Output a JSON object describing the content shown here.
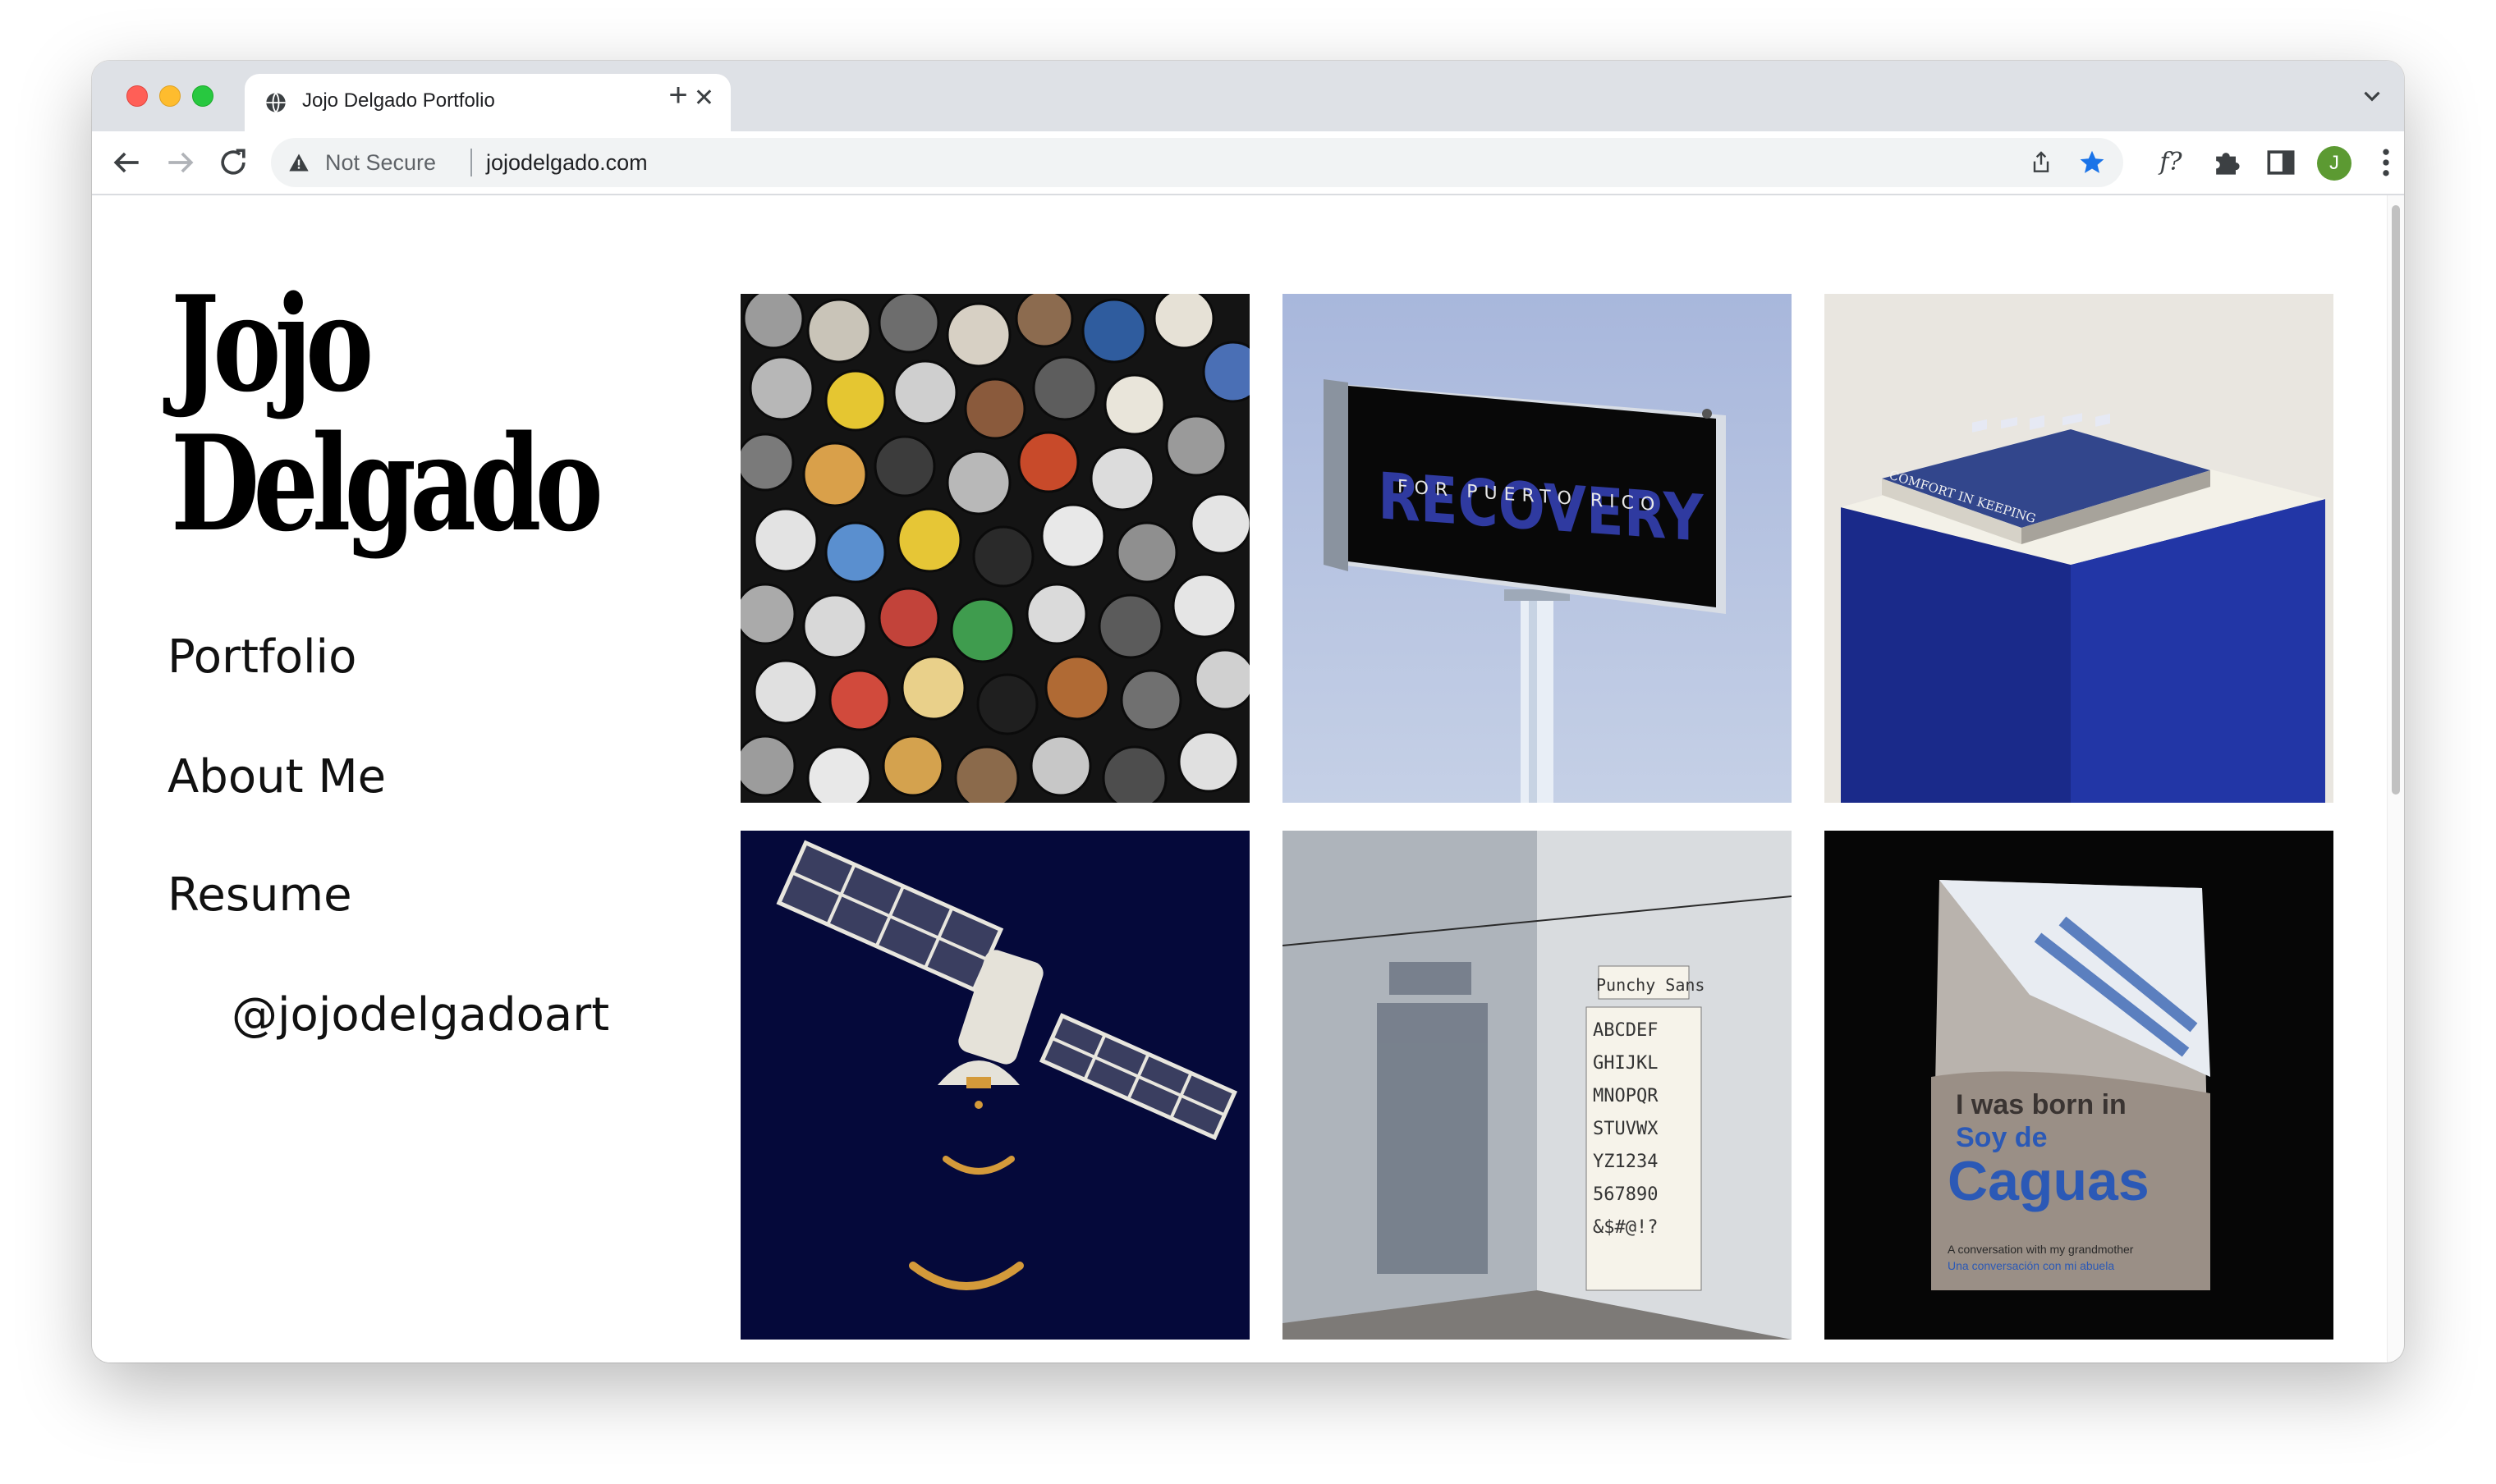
{
  "browser": {
    "tab_title": "Jojo Delgado Portfolio",
    "tab_close": "✕",
    "new_tab": "+",
    "security_label": "Not Secure",
    "url": "jojodelgado.com",
    "profile_initial": "J",
    "ext_font_label": "f?",
    "icons": [
      "globe-icon",
      "back-icon",
      "forward-icon",
      "reload-icon",
      "warning-icon",
      "share-icon",
      "star-icon",
      "puzzle-icon",
      "side-panel-icon",
      "kebab-menu-icon",
      "tab-search-icon"
    ]
  },
  "site": {
    "logo_line1": "Jojo",
    "logo_line2": "Delgado",
    "nav": {
      "portfolio": "Portfolio",
      "about": "About Me",
      "resume": "Resume",
      "instagram": "@jojodelgadoart"
    }
  },
  "gallery": {
    "tile2_text_main": "RECOVERY",
    "tile2_text_sub": "FOR PUERTO RICO",
    "tile3_text": "COMFORT IN KEEPING",
    "tile5_text_1": "Punchy Sans",
    "tile6_text_1": "I was born in",
    "tile6_text_2": "Soy de",
    "tile6_text_3": "Caguas",
    "tile6_text_4": "A conversation with my grandmother",
    "tile6_text_5": "Una conversación con mi abuela"
  },
  "colors": {
    "accent_star": "#1a73e8",
    "avatar": "#5c9a32",
    "satellite_bg": "#05093a",
    "billboard_sky": "#aab9dc"
  }
}
